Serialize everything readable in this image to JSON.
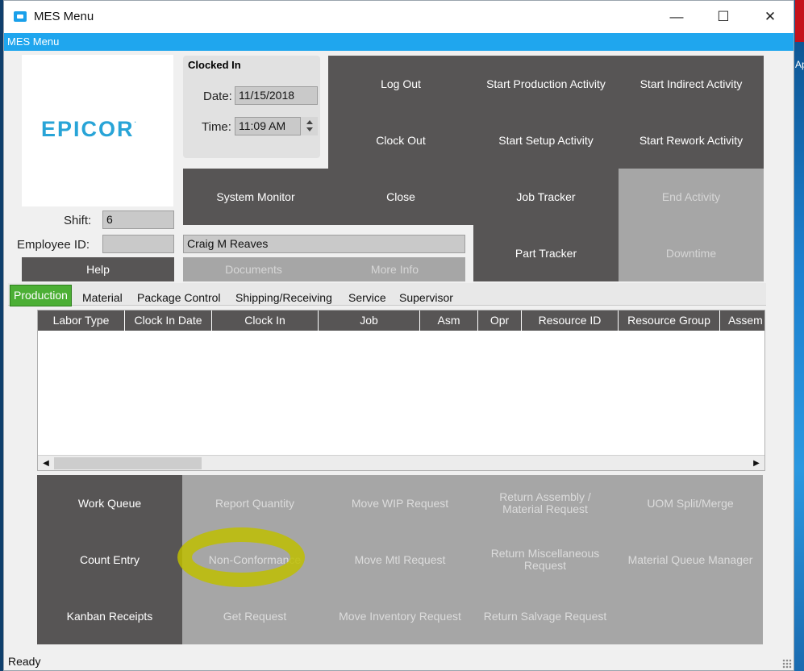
{
  "window": {
    "title": "MES Menu",
    "menubar_label": "MES Menu",
    "controls": {
      "minimize": "—",
      "maximize": "☐",
      "close": "✕"
    }
  },
  "desktop": {
    "edge_text": "Ap"
  },
  "logo": {
    "text": "EPICOR",
    "mark": "."
  },
  "clocked_in": {
    "title": "Clocked In",
    "date_label": "Date:",
    "date_value": "11/15/2018",
    "time_label": "Time:",
    "time_value": "11:09 AM"
  },
  "employee": {
    "shift_label": "Shift:",
    "shift_value": "6",
    "id_label": "Employee ID:",
    "id_value": "",
    "name_value": "Craig M Reaves"
  },
  "buttons": {
    "log_out": "Log Out",
    "start_production": "Start Production Activity",
    "start_indirect": "Start Indirect Activity",
    "clock_out": "Clock Out",
    "start_setup": "Start Setup Activity",
    "start_rework": "Start Rework Activity",
    "system_monitor": "System Monitor",
    "close": "Close",
    "job_tracker": "Job Tracker",
    "end_activity": "End Activity",
    "part_tracker": "Part Tracker",
    "downtime": "Downtime",
    "help": "Help",
    "documents": "Documents",
    "more_info": "More Info"
  },
  "tabs": [
    "Production",
    "Material",
    "Package Control",
    "Shipping/Receiving",
    "Service",
    "Supervisor"
  ],
  "grid": {
    "columns": [
      "Labor Type",
      "Clock In Date",
      "Clock In",
      "Job",
      "Asm",
      "Opr",
      "Resource ID",
      "Resource Group",
      "Assem"
    ],
    "rows": []
  },
  "actions": {
    "work_queue": "Work Queue",
    "report_quantity": "Report Quantity",
    "move_wip_request": "Move WIP Request",
    "return_assembly_line1": "Return Assembly /",
    "return_assembly_line2": "Material Request",
    "uom_split_merge": "UOM Split/Merge",
    "count_entry": "Count Entry",
    "non_conformance": "Non-Conformance",
    "move_mtl_request": "Move Mtl Request",
    "return_misc_line1": "Return Miscellaneous",
    "return_misc_line2": "Request",
    "material_queue_manager": "Material Queue Manager",
    "kanban_receipts": "Kanban Receipts",
    "get_request": "Get Request",
    "move_inventory_request": "Move Inventory Request",
    "return_salvage_request": "Return Salvage Request"
  },
  "status": {
    "text": "Ready"
  },
  "colors": {
    "accent_blue": "#1fa6ee",
    "tile_dark": "#575555",
    "tile_disabled": "#a6a6a6",
    "tab_active": "#4caf35",
    "highlight": "#bebe00"
  }
}
